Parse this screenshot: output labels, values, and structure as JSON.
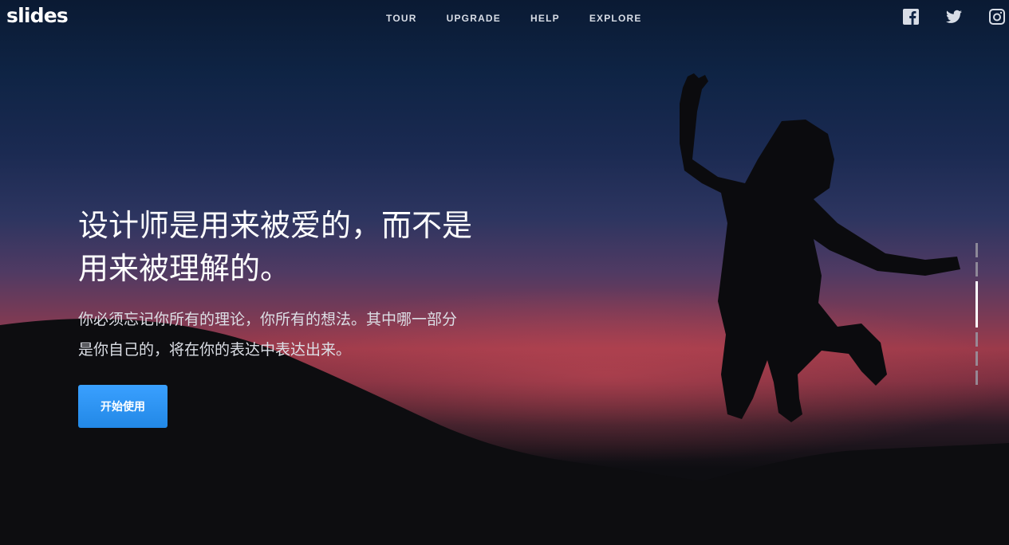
{
  "brand": {
    "logo": "slides"
  },
  "nav": {
    "items": [
      {
        "label": "TOUR"
      },
      {
        "label": "UPGRADE"
      },
      {
        "label": "HELP"
      },
      {
        "label": "EXPLORE"
      }
    ]
  },
  "social": [
    "facebook-icon",
    "twitter-icon",
    "instagram-icon"
  ],
  "hero": {
    "headline_line1": "设计师是用来被爱的，而不是",
    "headline_line2": "用来被理解的。",
    "subtitle_line1": "你必须忘记你所有的理论，你所有的想法。其中哪一部分",
    "subtitle_line2": "是你自己的，将在你的表达中表达出来。",
    "cta_label": "开始使用"
  },
  "pager": {
    "total": 7,
    "active_index": 2
  },
  "colors": {
    "accent": "#2b93f3",
    "text": "#ffffff",
    "nav_text": "#d8dde6"
  }
}
